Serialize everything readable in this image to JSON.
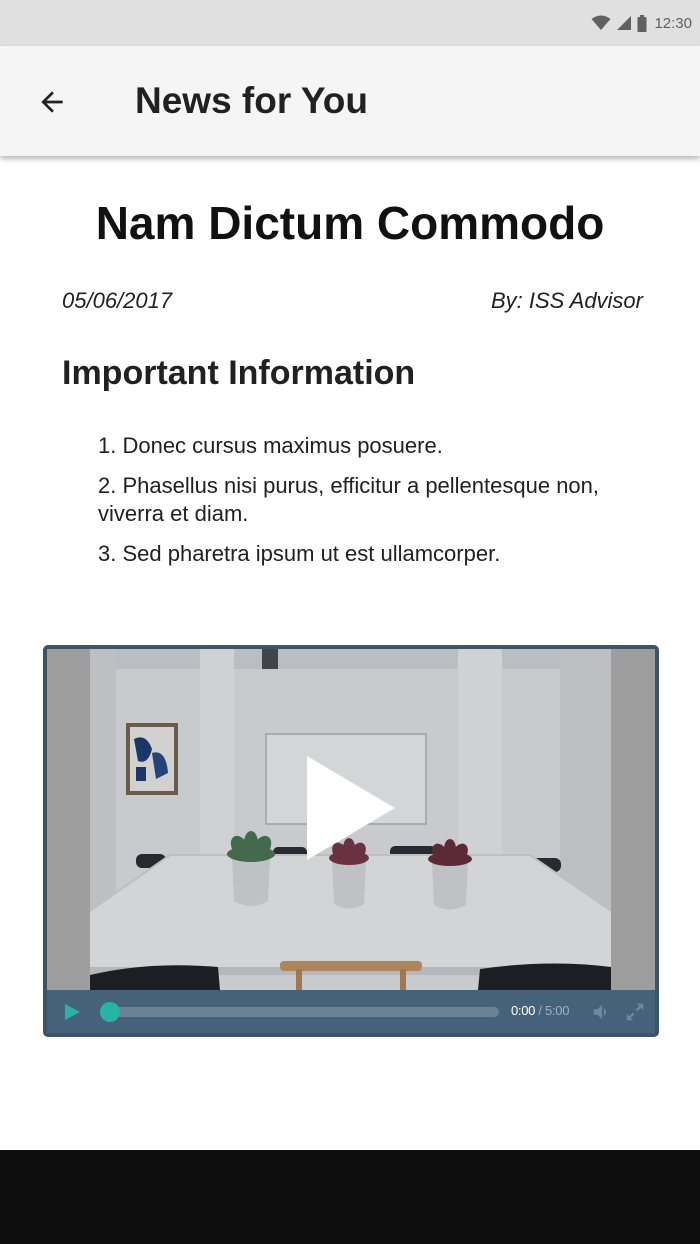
{
  "status_bar": {
    "time": "12:30",
    "icons": [
      "wifi-icon",
      "signal-icon",
      "battery-icon"
    ]
  },
  "app_bar": {
    "title": "News for You",
    "back_icon": "arrow-back-icon"
  },
  "article": {
    "title": "Nam Dictum Commodo",
    "date": "05/06/2017",
    "author": "By: ISS Advisor",
    "section_heading": "Important Information",
    "items": [
      "1. Donec cursus maximus posuere.",
      "2. Phasellus nisi purus, efficitur a pellentesque non, viverra et diam.",
      "3. Sed pharetra ipsum ut est ullamcorper."
    ]
  },
  "video": {
    "current_time": "0:00",
    "separator": "/",
    "total_time": "5:00",
    "progress": 0,
    "colors": {
      "frame": "#3b5567",
      "controls": "#46627a",
      "accent": "#26b5a3"
    }
  }
}
